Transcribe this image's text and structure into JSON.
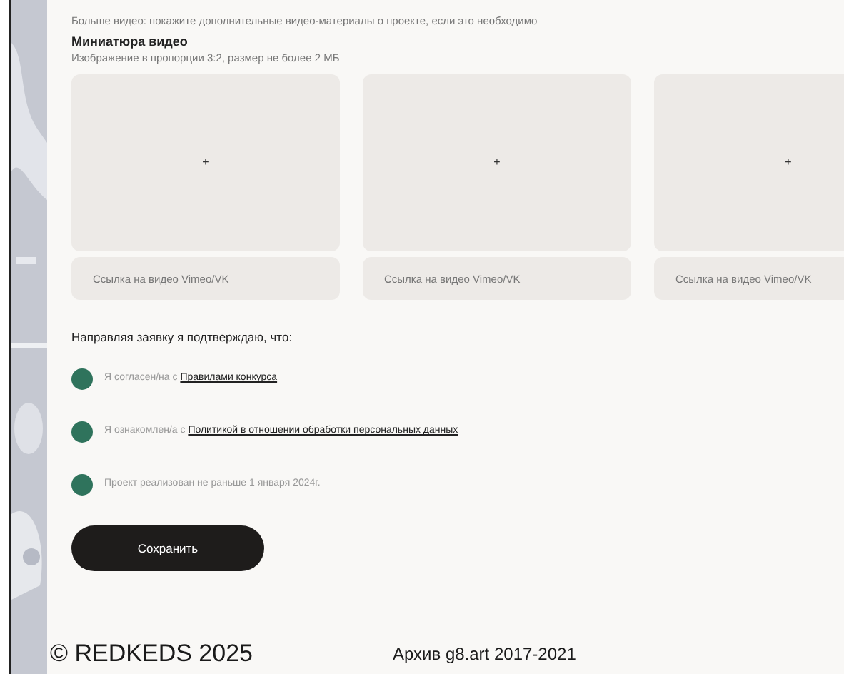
{
  "intro": "Больше видео: покажите дополнительные видео-материалы о проекте, если это необходимо",
  "thumbnail": {
    "title": "Миниатюра видео",
    "hint": "Изображение в пропорции 3:2, размер не более 2 МБ"
  },
  "videos": [
    {
      "upload_icon": "+",
      "placeholder": "Ссылка на видео Vimeo/VK"
    },
    {
      "upload_icon": "+",
      "placeholder": "Ссылка на видео Vimeo/VK"
    },
    {
      "upload_icon": "+",
      "placeholder": "Ссылка на видео Vimeo/VK"
    }
  ],
  "confirm": {
    "title": "Направляя заявку я подтверждаю, что:",
    "items": [
      {
        "checked": true,
        "text": "Я согласен/на с ",
        "link": "Правилами конкурса"
      },
      {
        "checked": true,
        "text": "Я ознакомлен/а с ",
        "link": "Политикой в отношении обработки персональных данных"
      },
      {
        "checked": true,
        "text": "Проект реализован не раньше 1 января 2024г."
      }
    ]
  },
  "save_button": "Сохранить",
  "footer": {
    "copyright": "© REDKEDS 2025",
    "archive": "Архив g8.art 2017-2021"
  }
}
